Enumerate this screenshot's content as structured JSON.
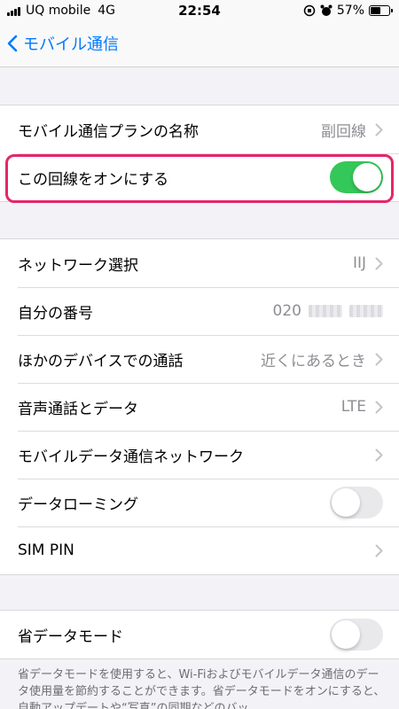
{
  "status_bar": {
    "carrier": "UQ mobile",
    "network": "4G",
    "time": "22:54",
    "battery": "57%",
    "battery_level": 0.57
  },
  "nav": {
    "back_label": "モバイル通信"
  },
  "group1": {
    "plan_label": "モバイル通信プランの名称",
    "plan_value": "副回線",
    "line_on_label": "この回線をオンにする",
    "line_on_state": true
  },
  "group2": {
    "network_label": "ネットワーク選択",
    "network_value": "IIJ",
    "my_number_label": "自分の番号",
    "my_number_value": "020",
    "other_devices_label": "ほかのデバイスでの通話",
    "other_devices_value": "近くにあるとき",
    "voice_data_label": "音声通話とデータ",
    "voice_data_value": "LTE",
    "mobile_data_network_label": "モバイルデータ通信ネットワーク",
    "roaming_label": "データローミング",
    "roaming_state": false,
    "sim_pin_label": "SIM PIN"
  },
  "group3": {
    "low_data_label": "省データモード",
    "low_data_state": false,
    "footer_text": "省データモードを使用すると、Wi-Fiおよびモバイルデータ通信のデータ使用量を節約することができます。省データモードをオンにすると、自動アップデートや“写真”の同期などのバッ"
  },
  "colors": {
    "accent": "#007aff",
    "toggle_on": "#34c759",
    "highlight": "#e5266b"
  }
}
